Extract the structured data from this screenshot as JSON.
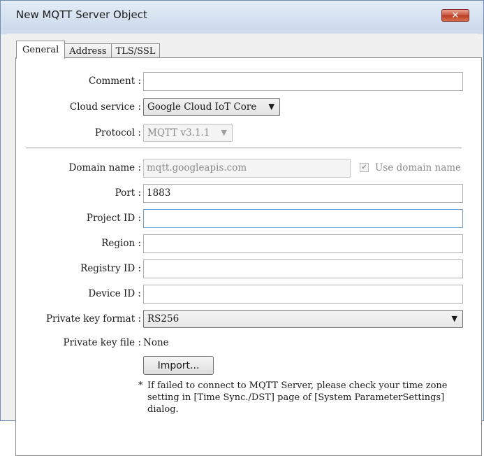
{
  "window": {
    "title": "New MQTT Server Object",
    "close_icon": "close-icon"
  },
  "tabs": [
    {
      "label": "General",
      "active": true
    },
    {
      "label": "Address",
      "active": false
    },
    {
      "label": "TLS/SSL",
      "active": false
    }
  ],
  "form": {
    "comment": {
      "label": "Comment :",
      "value": ""
    },
    "cloud_service": {
      "label": "Cloud service :",
      "value": "Google Cloud IoT Core"
    },
    "protocol": {
      "label": "Protocol :",
      "value": "MQTT v3.1.1",
      "disabled": true
    },
    "domain_name": {
      "label": "Domain name :",
      "value": "mqtt.googleapis.com",
      "disabled": true
    },
    "use_domain_name": {
      "label": "Use domain name",
      "checked": true,
      "disabled": true
    },
    "port": {
      "label": "Port :",
      "value": "1883"
    },
    "project_id": {
      "label": "Project ID :",
      "value": ""
    },
    "region": {
      "label": "Region :",
      "value": ""
    },
    "registry_id": {
      "label": "Registry ID :",
      "value": ""
    },
    "device_id": {
      "label": "Device ID :",
      "value": ""
    },
    "private_key_format": {
      "label": "Private key format :",
      "value": "RS256"
    },
    "private_key_file": {
      "label": "Private key file :",
      "value": "None"
    },
    "import_button": "Import...",
    "note_star": "*",
    "note": "If failed to connect to MQTT Server, please check your time zone setting in [Time Sync./DST] page of [System ParameterSettings] dialog."
  },
  "colors": {
    "title_bg": "#dbe6f4",
    "close_red": "#c9553d",
    "focus_blue": "#6f9fd3"
  }
}
